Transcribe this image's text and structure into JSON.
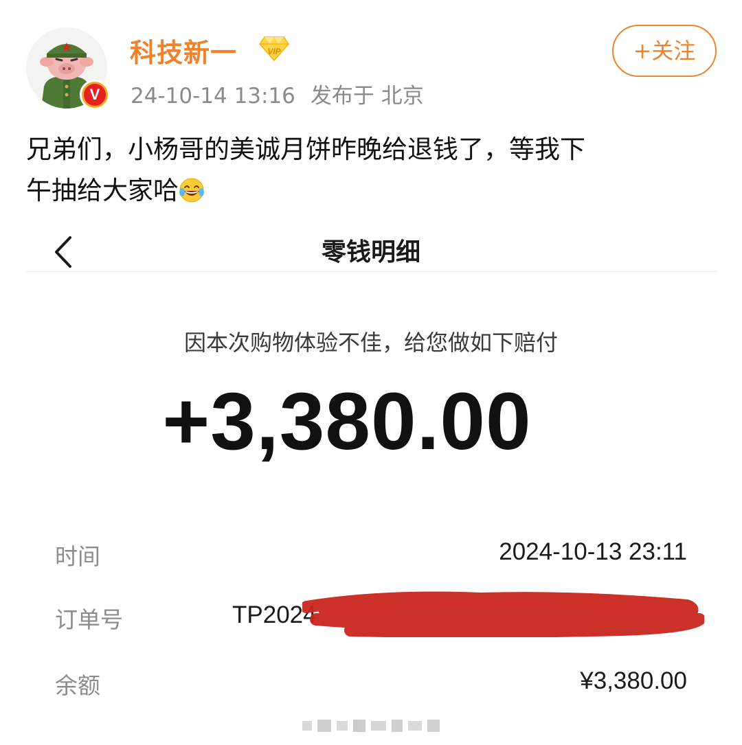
{
  "post": {
    "username": "科技新一",
    "timestamp": "24-10-14 13:16",
    "published_at": "发布于 北京",
    "follow_label": "+关注",
    "text_line1": "兄弟们，小杨哥的美诚月饼昨晚给退钱了，等我下",
    "text_line2": "午抽给大家哈",
    "emoji": "laughing-tears-emoji",
    "accent_color": "#f0822a",
    "badges": [
      "vip-diamond-icon",
      "verified-v-icon"
    ]
  },
  "wallet": {
    "title": "零钱明细",
    "reason": "因本次购物体验不佳，给您做如下赔付",
    "amount": "+3,380.00",
    "rows": {
      "time_label": "时间",
      "time_value": "2024-10-13 23:11",
      "order_label": "订单号",
      "order_value_visible": "TP2024",
      "balance_label": "余额",
      "balance_value": "¥3,380.00"
    },
    "redaction_color": "#c8261c"
  }
}
